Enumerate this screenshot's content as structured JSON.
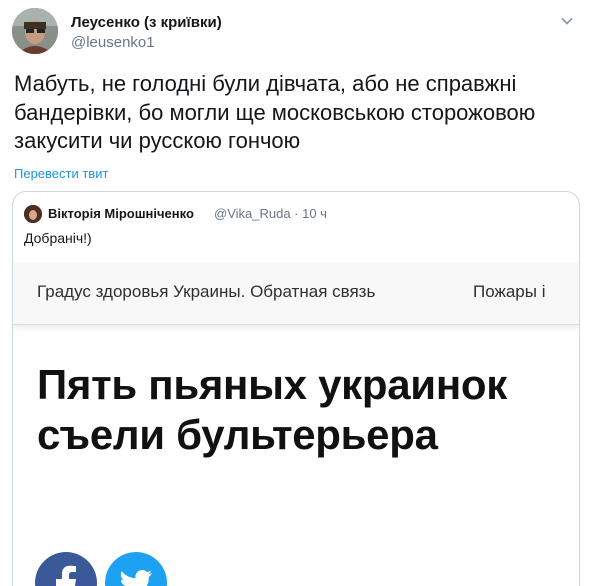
{
  "tweet": {
    "author_name": "Леусенко (з криївки)",
    "author_handle": "@leusenko1",
    "text": "Мабуть, не голодні були дівчата, або не справжні бандерівки, бо могли ще московською сторожовою закусити чи русскою гончою",
    "translate_label": "Перевести твит",
    "menu_icon": "chevron-down-icon"
  },
  "quoted_tweet": {
    "author_name": "Вікторія Мірошніченко",
    "meta": "@Vika_Ruda · 10 ч",
    "text": "Добраніч!)",
    "media": {
      "nav_items": [
        "Градус здоровья Украины. Обратная связь",
        "Пожары і"
      ],
      "headline": "Пять пьяных украинок съели бультерьера",
      "share_icons": [
        "facebook-icon",
        "twitter-icon"
      ]
    }
  },
  "colors": {
    "link": "#1b95e0",
    "secondary_text": "#657786",
    "border": "#ccd6dd",
    "facebook": "#3b5998",
    "twitter": "#1da1f2"
  }
}
